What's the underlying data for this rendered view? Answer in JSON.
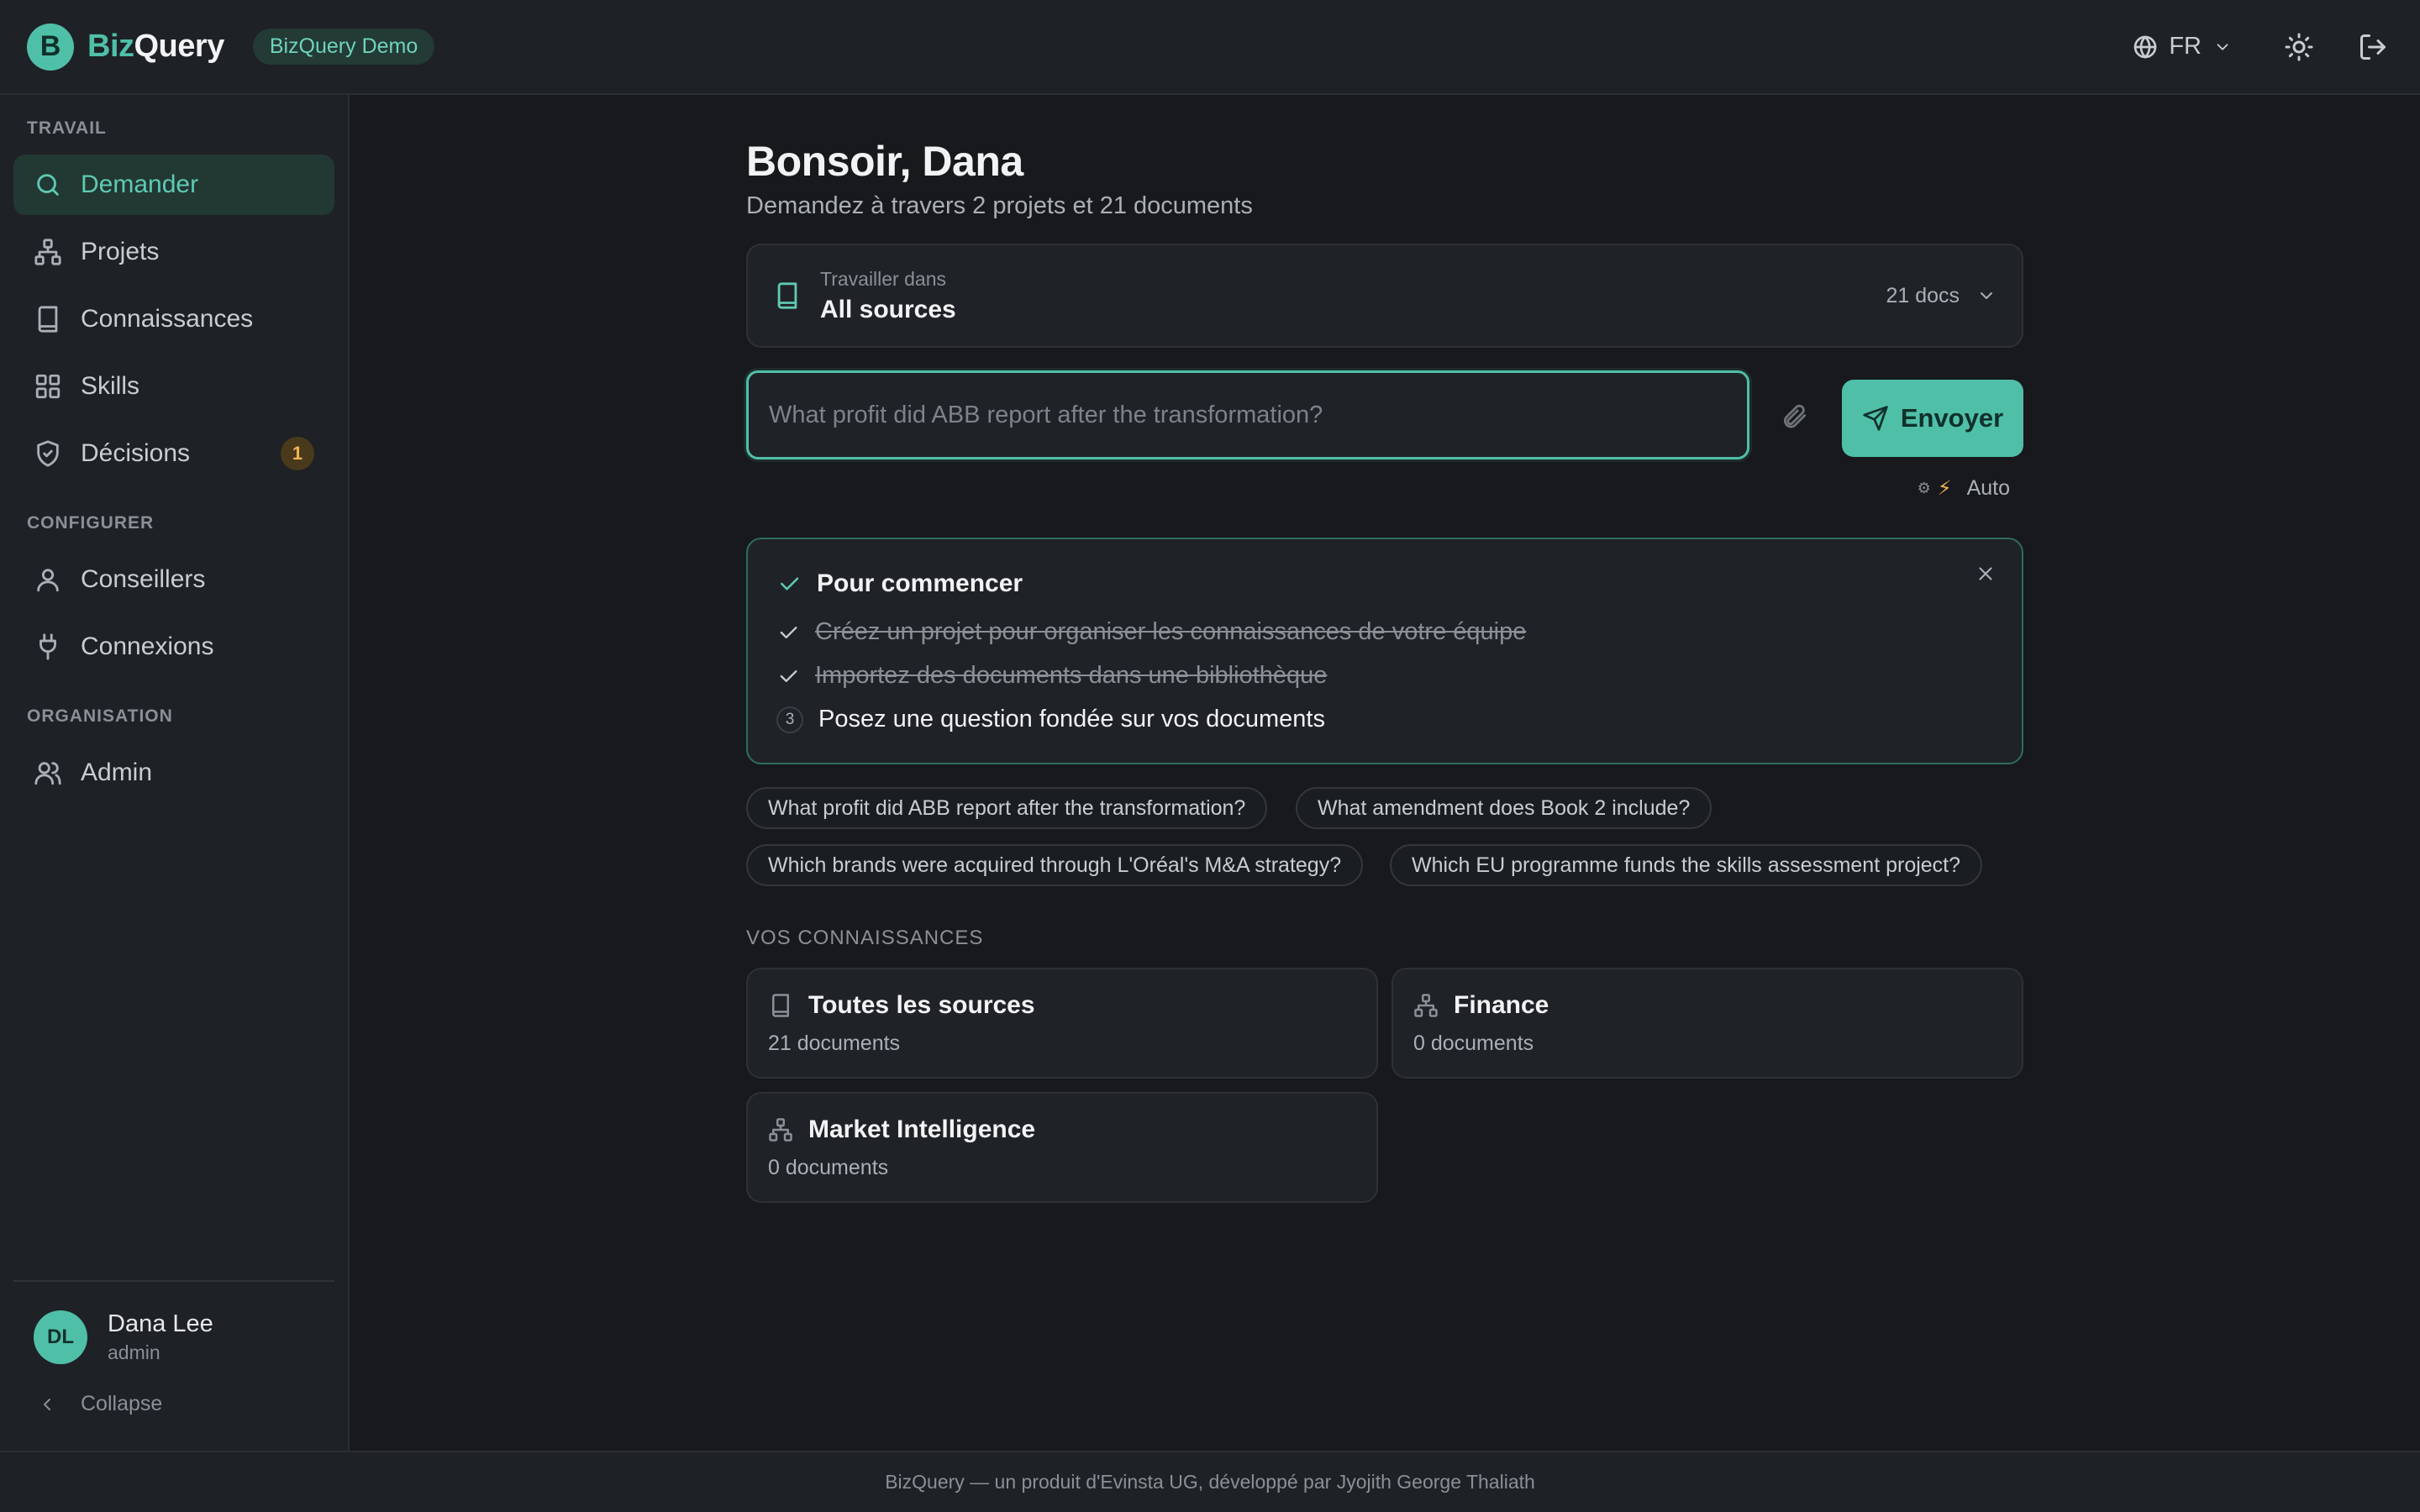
{
  "header": {
    "logo_letter": "B",
    "brand_part1": "Biz",
    "brand_part2": "Query",
    "demo_badge": "BizQuery Demo",
    "language": "FR"
  },
  "sidebar": {
    "sections": {
      "work": "TRAVAIL",
      "configure": "CONFIGURER",
      "organization": "ORGANISATION"
    },
    "items": [
      {
        "label": "Demander",
        "icon": "search-icon",
        "active": true
      },
      {
        "label": "Projets",
        "icon": "sitemap-icon"
      },
      {
        "label": "Connaissances",
        "icon": "book-icon"
      },
      {
        "label": "Skills",
        "icon": "grid-icon"
      },
      {
        "label": "Décisions",
        "icon": "shield-check-icon",
        "badge": "1"
      },
      {
        "label": "Conseillers",
        "icon": "user-icon"
      },
      {
        "label": "Connexions",
        "icon": "plug-icon"
      },
      {
        "label": "Admin",
        "icon": "users-icon"
      }
    ],
    "user": {
      "initials": "DL",
      "name": "Dana Lee",
      "role": "admin"
    },
    "collapse_label": "Collapse"
  },
  "main": {
    "greeting": "Bonsoir, Dana",
    "subtitle": "Demandez à travers 2 projets et 21 documents",
    "source": {
      "small_label": "Travailler dans",
      "value": "All sources",
      "count": "21 docs"
    },
    "query": {
      "placeholder": "What profit did ABB report after the transformation?",
      "value": ""
    },
    "send_label": "Envoyer",
    "mode_label": "Auto",
    "getting_started": {
      "title": "Pour commencer",
      "steps": [
        {
          "label": "Créez un projet pour organiser les connaissances de votre équipe",
          "done": true
        },
        {
          "label": "Importez des documents dans une bibliothèque",
          "done": true
        },
        {
          "label": "Posez une question fondée sur vos documents",
          "done": false,
          "number": "3"
        }
      ]
    },
    "suggestions": [
      "What profit did ABB report after the transformation?",
      "What amendment does Book 2 include?",
      "Which brands were acquired through L'Oréal's M&A strategy?",
      "Which EU programme funds the skills assessment project?"
    ],
    "knowledge": {
      "label": "VOS CONNAISSANCES",
      "cards": [
        {
          "title": "Toutes les sources",
          "subtitle": "21 documents",
          "icon": "book-icon"
        },
        {
          "title": "Finance",
          "subtitle": "0 documents",
          "icon": "sitemap-icon"
        },
        {
          "title": "Market Intelligence",
          "subtitle": "0 documents",
          "icon": "sitemap-icon"
        }
      ]
    }
  },
  "footer": {
    "text": "BizQuery — un produit d'Evinsta UG, développé par Jyojith George Thaliath"
  },
  "colors": {
    "accent": "#4fbfa8",
    "background": "#17191c",
    "panel": "#1e2125",
    "badge": "#f0b454"
  }
}
